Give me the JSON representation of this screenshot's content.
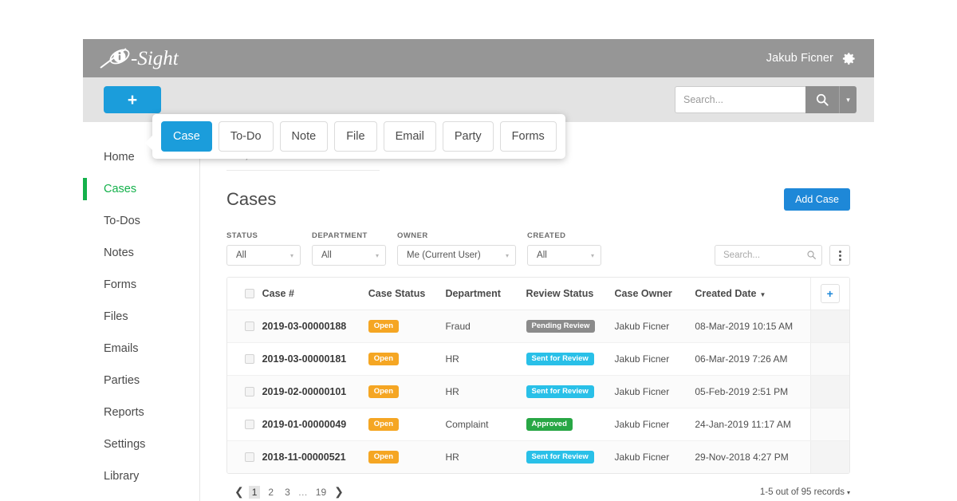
{
  "brand": {
    "name": "i-Sight",
    "logo_icon": "isight-logo"
  },
  "topbar": {
    "user_name": "Jakub Ficner",
    "gear_icon": "gear-icon"
  },
  "actionbar": {
    "add_label": "+",
    "search_placeholder": "Search...",
    "search_value": "",
    "search_icon": "search-icon",
    "caret_icon": "chevron-down-icon"
  },
  "popover": {
    "items": [
      {
        "label": "Case",
        "active": true
      },
      {
        "label": "To-Do",
        "active": false
      },
      {
        "label": "Note",
        "active": false
      },
      {
        "label": "File",
        "active": false
      },
      {
        "label": "Email",
        "active": false
      },
      {
        "label": "Party",
        "active": false
      },
      {
        "label": "Forms",
        "active": false
      }
    ]
  },
  "sidebar": {
    "items": [
      {
        "label": "Home",
        "active": false
      },
      {
        "label": "Cases",
        "active": true
      },
      {
        "label": "To-Dos",
        "active": false
      },
      {
        "label": "Notes",
        "active": false
      },
      {
        "label": "Forms",
        "active": false
      },
      {
        "label": "Files",
        "active": false
      },
      {
        "label": "Emails",
        "active": false
      },
      {
        "label": "Parties",
        "active": false
      },
      {
        "label": "Reports",
        "active": false
      },
      {
        "label": "Settings",
        "active": false
      },
      {
        "label": "Library",
        "active": false
      }
    ],
    "active_color": "#14b14b"
  },
  "breadcrumb": {
    "items": [
      "Cases",
      "All",
      "All",
      "Me (Current User)",
      "All"
    ],
    "separator": "/"
  },
  "page": {
    "title": "Cases",
    "add_case_label": "Add Case",
    "accent_color": "#1e88d8"
  },
  "filters": [
    {
      "label": "STATUS",
      "value": "All",
      "wide": false
    },
    {
      "label": "DEPARTMENT",
      "value": "All",
      "wide": false
    },
    {
      "label": "OWNER",
      "value": "Me (Current User)",
      "wide": true
    },
    {
      "label": "CREATED",
      "value": "All",
      "wide": false
    }
  ],
  "table_toolbar": {
    "search_placeholder": "Search...",
    "search_value": "",
    "search_icon": "search-icon",
    "kebab_icon": "more-vertical-icon"
  },
  "table": {
    "columns": [
      {
        "key": "check",
        "label": ""
      },
      {
        "key": "case_number",
        "label": "Case #"
      },
      {
        "key": "case_status",
        "label": "Case Status"
      },
      {
        "key": "department",
        "label": "Department"
      },
      {
        "key": "review_status",
        "label": "Review Status"
      },
      {
        "key": "case_owner",
        "label": "Case Owner"
      },
      {
        "key": "created_date",
        "label": "Created Date"
      },
      {
        "key": "actions",
        "label": "+"
      }
    ],
    "sorted_column": "Created Date",
    "sort_direction": "desc",
    "add_column_label": "+",
    "rows": [
      {
        "case_number": "2019-03-00000188",
        "case_status": "Open",
        "case_status_color": "#f5a623",
        "department": "Fraud",
        "review_status": "Pending Review",
        "review_status_color": "#8b8b8b",
        "case_owner": "Jakub Ficner",
        "created_date": "08-Mar-2019 10:15 AM"
      },
      {
        "case_number": "2019-03-00000181",
        "case_status": "Open",
        "case_status_color": "#f5a623",
        "department": "HR",
        "review_status": "Sent for Review",
        "review_status_color": "#29c0e8",
        "case_owner": "Jakub Ficner",
        "created_date": "06-Mar-2019 7:26 AM"
      },
      {
        "case_number": "2019-02-00000101",
        "case_status": "Open",
        "case_status_color": "#f5a623",
        "department": "HR",
        "review_status": "Sent for Review",
        "review_status_color": "#29c0e8",
        "case_owner": "Jakub Ficner",
        "created_date": "05-Feb-2019 2:51 PM"
      },
      {
        "case_number": "2019-01-00000049",
        "case_status": "Open",
        "case_status_color": "#f5a623",
        "department": "Complaint",
        "review_status": "Approved",
        "review_status_color": "#28a745",
        "case_owner": "Jakub Ficner",
        "created_date": "24-Jan-2019 11:17 AM"
      },
      {
        "case_number": "2018-11-00000521",
        "case_status": "Open",
        "case_status_color": "#f5a623",
        "department": "HR",
        "review_status": "Sent for Review",
        "review_status_color": "#29c0e8",
        "case_owner": "Jakub Ficner",
        "created_date": "29-Nov-2018 4:27 PM"
      }
    ]
  },
  "pagination": {
    "prev_icon": "chevron-left-icon",
    "next_icon": "chevron-right-icon",
    "pages": [
      "1",
      "2",
      "3",
      "…",
      "19"
    ],
    "current_page": "1",
    "record_summary": "1-5 out of 95 records",
    "record_range": "1-5",
    "record_total": "95"
  }
}
